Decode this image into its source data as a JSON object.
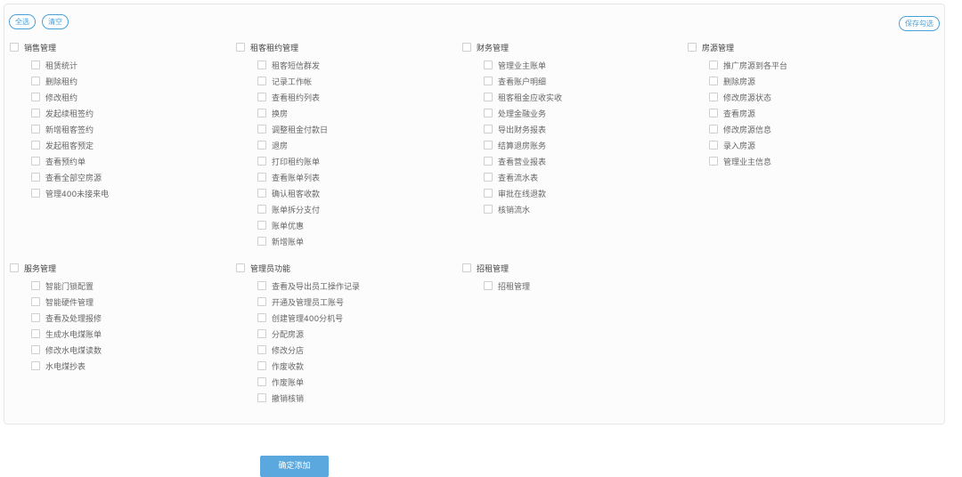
{
  "toolbar": {
    "select_all": "全选",
    "clear": "清空",
    "save": "保存勾选"
  },
  "groups": [
    {
      "title": "销售管理",
      "items": [
        "租赁统计",
        "删除租约",
        "修改租约",
        "发起续租签约",
        "新增租客签约",
        "发起租客预定",
        "查看预约单",
        "查看全部空房源",
        "管理400未接来电"
      ]
    },
    {
      "title": "租客租约管理",
      "items": [
        "租客短信群发",
        "记录工作帐",
        "查看租约列表",
        "换房",
        "调整租金付款日",
        "退房",
        "打印租约账单",
        "查看账单列表",
        "确认租客收款",
        "账单拆分支付",
        "账单优惠",
        "新增账单"
      ]
    },
    {
      "title": "财务管理",
      "items": [
        "管理业主账单",
        "查看账户明细",
        "租客租金应收实收",
        "处理金融业务",
        "导出财务报表",
        "结算退房账务",
        "查看营业报表",
        "查看流水表",
        "审批在线退款",
        "核销流水"
      ]
    },
    {
      "title": "房源管理",
      "items": [
        "推广房源到各平台",
        "删除房源",
        "修改房源状态",
        "查看房源",
        "修改房源信息",
        "录入房源",
        "管理业主信息"
      ]
    },
    {
      "title": "服务管理",
      "items": [
        "智能门锁配置",
        "智能硬件管理",
        "查看及处理报修",
        "生成水电煤账单",
        "修改水电煤读数",
        "水电煤抄表"
      ]
    },
    {
      "title": "管理员功能",
      "items": [
        "查看及导出员工操作记录",
        "开通及管理员工账号",
        "创建管理400分机号",
        "分配房源",
        "修改分店",
        "作废收款",
        "作废账单",
        "撤销核销"
      ]
    },
    {
      "title": "招租管理",
      "items": [
        "招租管理"
      ]
    }
  ],
  "footer": {
    "confirm": "确定添加"
  }
}
